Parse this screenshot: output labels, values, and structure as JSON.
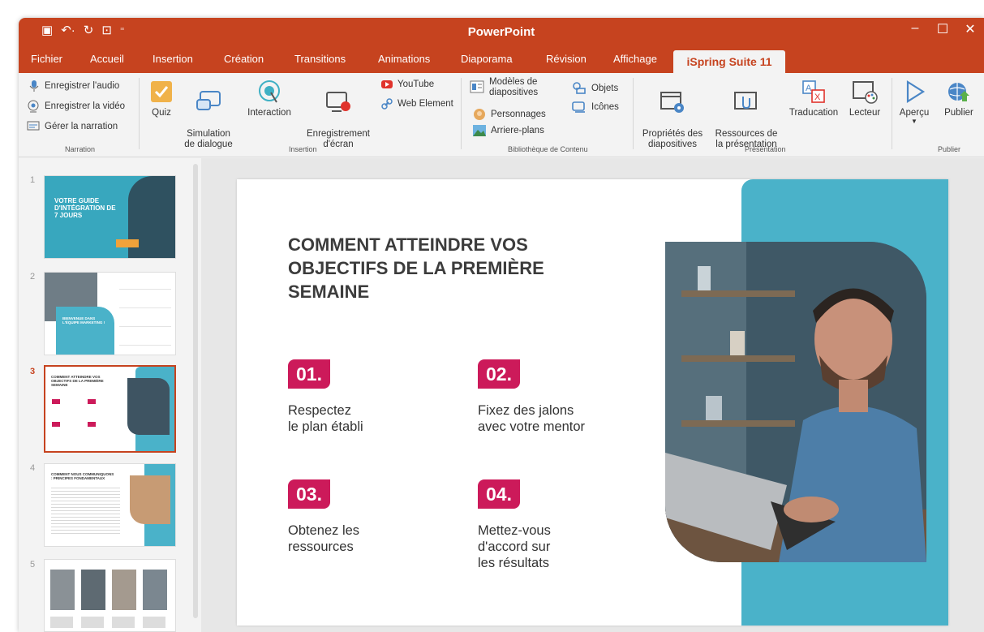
{
  "app": {
    "title": "PowerPoint"
  },
  "tabs": [
    "Fichier",
    "Accueil",
    "Insertion",
    "Création",
    "Transitions",
    "Animations",
    "Diaporama",
    "Révision",
    "Affichage"
  ],
  "active_tab": "iSpring Suite 11",
  "ribbon": {
    "narration": {
      "items": [
        "Enregistrer l'audio",
        "Enregistrer la vidéo",
        "Gérer la narration"
      ],
      "label": "Narration"
    },
    "insertion": {
      "quiz": "Quiz",
      "simulation": "Simulation\nde dialogue",
      "interaction": "Interaction",
      "recording": "Enregistrement\nd'écran",
      "youtube": "YouTube",
      "web": "Web Element",
      "label": "Insertion"
    },
    "library": {
      "templates": "Modèles de\ndiapositives",
      "characters": "Personnages",
      "backgrounds": "Arriere-plans",
      "objects": "Objets",
      "icons": "Icônes",
      "label": "Bibliothèque de Contenu"
    },
    "presentation": {
      "props": "Propriétés des\ndiapositives",
      "resources": "Ressources de\nla présentation",
      "translation": "Traducation",
      "player": "Lecteur",
      "label": "Présentation"
    },
    "publish": {
      "preview": "Aperçu",
      "publish": "Publier",
      "label": "Publier"
    }
  },
  "thumbnails": [
    {
      "number": "1",
      "title": "VOTRE GUIDE\nD'INTÉGRATION DE\n7 JOURS"
    },
    {
      "number": "2",
      "title": "BIENVENUE DANS\nL'ÉQUIPE MARKETING !"
    },
    {
      "number": "3",
      "title": "COMMENT ATTEINDRE VOS\nOBJECTIFS DE LA PREMIÈRE\nSEMAINE"
    },
    {
      "number": "4",
      "title": "COMMENT NOUS COMMUNIQUONS\n: PRINCIPES FONDAMENTAUX"
    },
    {
      "number": "5",
      "title": ""
    }
  ],
  "slide": {
    "title": "COMMENT ATTEINDRE VOS OBJECTIFS DE LA PREMIÈRE SEMAINE",
    "items": [
      {
        "num": "01.",
        "text": "Respectez\nle plan établi"
      },
      {
        "num": "02.",
        "text": "Fixez des jalons\navec votre mentor"
      },
      {
        "num": "03.",
        "text": "Obtenez les\nressources"
      },
      {
        "num": "04.",
        "text": "Mettez-vous\nd'accord sur\nles résultats"
      }
    ]
  },
  "colors": {
    "accent": "#c6431f",
    "teal": "#4ab2c9",
    "badge": "#cc1a5a"
  }
}
